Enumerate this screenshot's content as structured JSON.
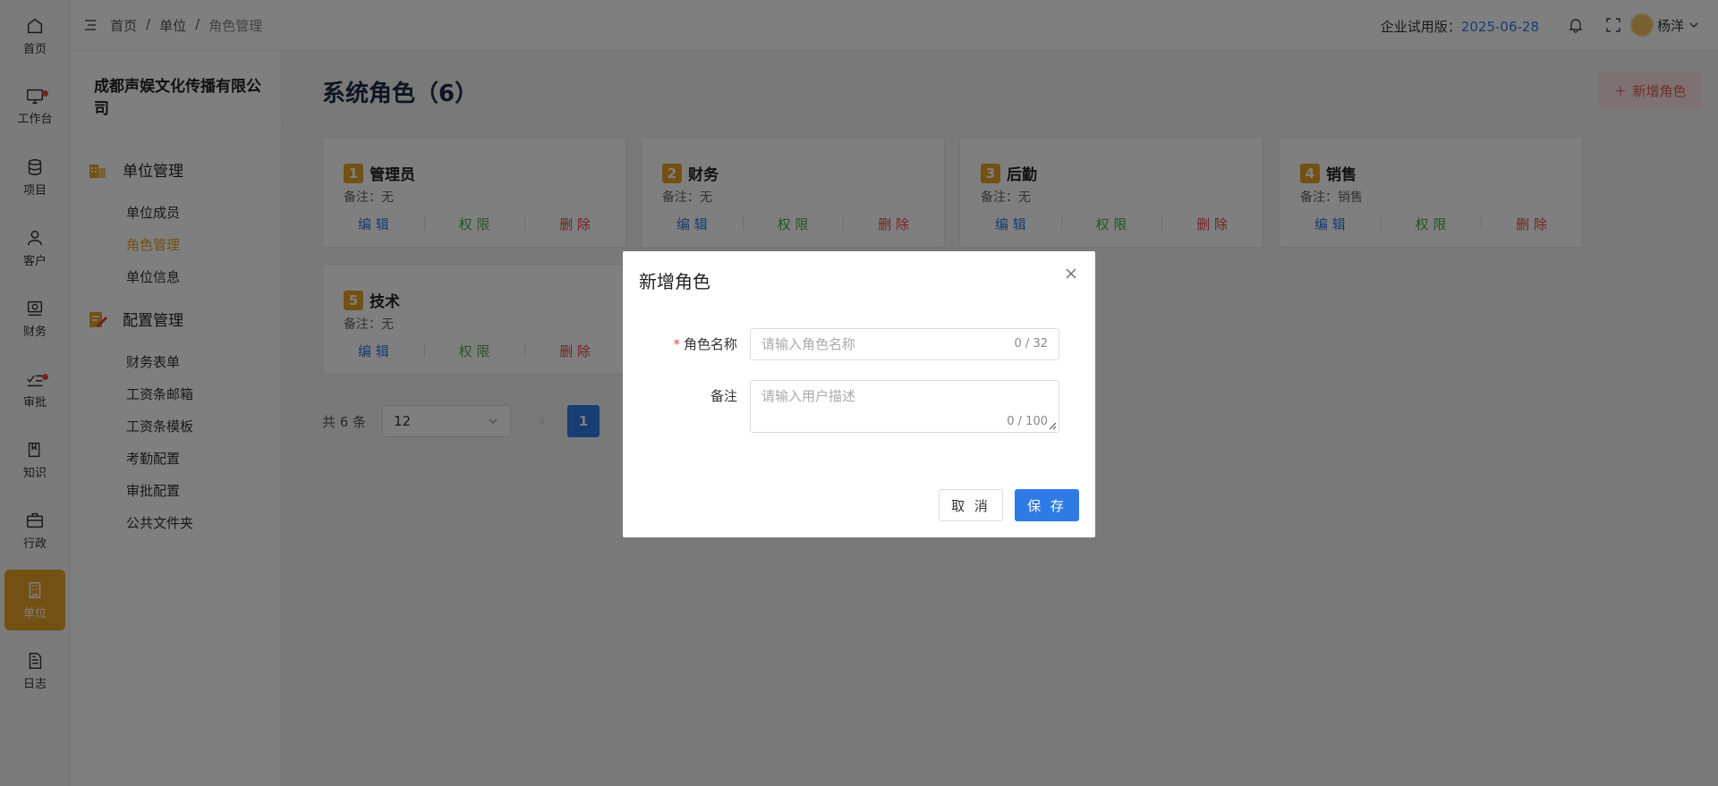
{
  "rail": [
    {
      "label": "首页",
      "icon": "home-icon"
    },
    {
      "label": "工作台",
      "icon": "monitor-icon",
      "dot": true
    },
    {
      "label": "项目",
      "icon": "database-icon"
    },
    {
      "label": "客户",
      "icon": "user-icon"
    },
    {
      "label": "财务",
      "icon": "finance-icon"
    },
    {
      "label": "审批",
      "icon": "approve-icon",
      "dot": true
    },
    {
      "label": "知识",
      "icon": "book-icon"
    },
    {
      "label": "行政",
      "icon": "briefcase-icon"
    },
    {
      "label": "单位",
      "icon": "building-icon",
      "active": true
    },
    {
      "label": "日志",
      "icon": "log-icon"
    }
  ],
  "sidebar": {
    "company": "成都声娱文化传播有限公司",
    "groups": [
      {
        "title": "单位管理",
        "items": [
          "单位成员",
          "角色管理",
          "单位信息"
        ]
      },
      {
        "title": "配置管理",
        "items": [
          "财务表单",
          "工资条邮箱",
          "工资条模板",
          "考勤配置",
          "审批配置",
          "公共文件夹"
        ]
      }
    ],
    "active_item": "角色管理"
  },
  "header": {
    "breadcrumb": [
      "首页",
      "/",
      "单位",
      "/",
      "角色管理"
    ],
    "trial_label": "企业试用版：",
    "trial_date": "2025-06-28",
    "user_name": "杨洋"
  },
  "main": {
    "title": "系统角色（6）",
    "add_button": "新增角色",
    "roles": [
      {
        "no": "1",
        "name": "管理员",
        "remark": "备注：无"
      },
      {
        "no": "2",
        "name": "财务",
        "remark": "备注：无"
      },
      {
        "no": "3",
        "name": "后勤",
        "remark": "备注：无"
      },
      {
        "no": "4",
        "name": "销售",
        "remark": "备注：销售"
      },
      {
        "no": "5",
        "name": "技术",
        "remark": "备注：无"
      }
    ],
    "actions": {
      "edit": "编 辑",
      "permission": "权 限",
      "delete": "删 除"
    },
    "pagination": {
      "total": "共 6 条",
      "page_size": "12",
      "current_page": "1",
      "prev": "‹"
    }
  },
  "modal": {
    "title": "新增角色",
    "name_label": "角色名称",
    "name_placeholder": "请输入角色名称",
    "name_count": "0 / 32",
    "remark_label": "备注",
    "remark_placeholder": "请输入用户描述",
    "remark_count": "0 / 100",
    "cancel": "取 消",
    "save": "保 存"
  },
  "colors": {
    "accent": "#e7a229",
    "primary": "#2f7be5",
    "danger": "#e5484d",
    "success": "#4caf50"
  }
}
